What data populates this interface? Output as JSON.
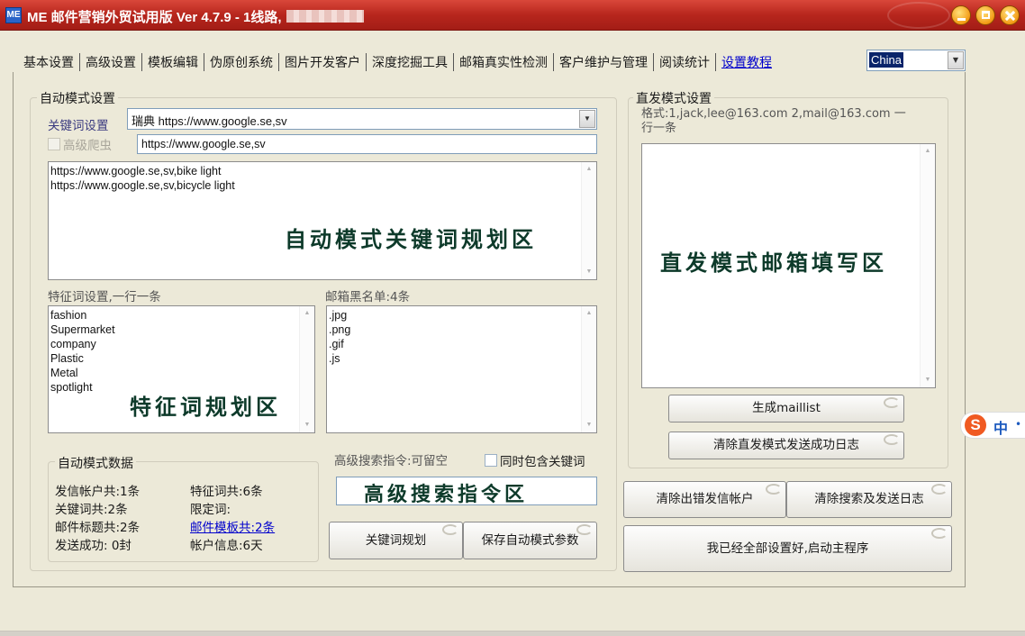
{
  "window": {
    "icon_text": "ME",
    "title": "ME 邮件营销外贸试用版 Ver 4.7.9 - 1线路,"
  },
  "tabs": [
    {
      "label": "基本设置"
    },
    {
      "label": "高级设置"
    },
    {
      "label": "模板编辑"
    },
    {
      "label": "伪原创系统"
    },
    {
      "label": "图片开发客户"
    },
    {
      "label": "深度挖掘工具"
    },
    {
      "label": "邮箱真实性检测"
    },
    {
      "label": "客户维护与管理"
    },
    {
      "label": "阅读统计"
    }
  ],
  "tutorial_link": "设置教程",
  "country_select": {
    "value": "China"
  },
  "auto_mode": {
    "title": "自动模式设置",
    "keyword_label": "关键词设置",
    "keyword_select": "瑞典 https://www.google.se,sv",
    "advanced_crawler_label": "高级爬虫",
    "url_value": "https://www.google.se,sv",
    "keyword_lines": [
      "https://www.google.se,sv,bike light",
      "https://www.google.se,sv,bicycle light"
    ],
    "keyword_area_watermark": "自动模式关键词规划区",
    "feature_label": "特征词设置,一行一条",
    "feature_lines": [
      "fashion",
      "Supermarket",
      "company",
      "Plastic",
      "Metal",
      "spotlight"
    ],
    "feature_area_watermark": "特征词规划区",
    "blacklist_label": "邮箱黑名单:4条",
    "blacklist_lines": [
      ".jpg",
      ".png",
      ".gif",
      ".js"
    ]
  },
  "auto_data": {
    "title": "自动模式数据",
    "send_accounts": "发信帐户共:1条",
    "keywords_total": "关键词共:2条",
    "subjects_total": "邮件标题共:2条",
    "sent_success": "发送成功: 0封",
    "features_total": "特征词共:6条",
    "limit_words": "限定词:",
    "templates_total": "邮件模板共:2条",
    "account_info": "帐户信息:6天"
  },
  "advanced_search": {
    "label": "高级搜索指令:可留空",
    "include_keyword_label": "同时包含关键词",
    "watermark": "高级搜索指令区"
  },
  "buttons": {
    "keyword_plan": "关键词规划",
    "save_auto": "保存自动模式参数",
    "generate_maillist": "生成maillist",
    "clear_direct_log": "清除直发模式发送成功日志",
    "clear_error_accounts": "清除出错发信帐户",
    "clear_search_log": "清除搜索及发送日志",
    "start_main": "我已经全部设置好,启动主程序"
  },
  "direct_mode": {
    "title": "直发模式设置",
    "format_hint": "格式:1,jack,lee@163.com 2,mail@163.com 一行一条",
    "watermark": "直发模式邮箱填写区"
  },
  "ime": {
    "logo": "S",
    "mode": "中"
  }
}
